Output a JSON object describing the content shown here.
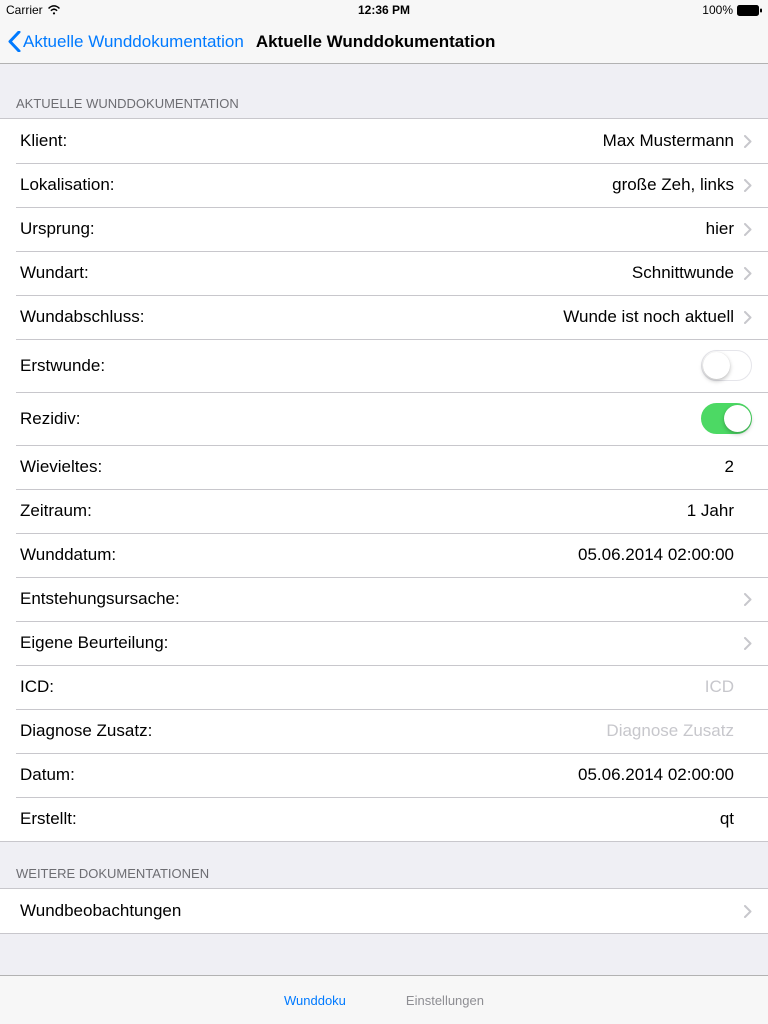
{
  "status": {
    "carrier": "Carrier",
    "time": "12:36 PM",
    "battery": "100%"
  },
  "nav": {
    "back_label": "Aktuelle Wunddokumentation",
    "title": "Aktuelle Wunddokumentation"
  },
  "section1": {
    "header": "AKTUELLE WUNDDOKUMENTATION",
    "klient_label": "Klient:",
    "klient_value": "Max Mustermann",
    "lokalisation_label": "Lokalisation:",
    "lokalisation_value": "große Zeh, links",
    "ursprung_label": "Ursprung:",
    "ursprung_value": "hier",
    "wundart_label": "Wundart:",
    "wundart_value": "Schnittwunde",
    "wundabschluss_label": "Wundabschluss:",
    "wundabschluss_value": "Wunde ist noch aktuell",
    "erstwunde_label": "Erstwunde:",
    "rezidiv_label": "Rezidiv:",
    "wievieltes_label": "Wievieltes:",
    "wievieltes_value": "2",
    "zeitraum_label": "Zeitraum:",
    "zeitraum_value": "1 Jahr",
    "wunddatum_label": "Wunddatum:",
    "wunddatum_value": "05.06.2014 02:00:00",
    "entstehungsursache_label": "Entstehungsursache:",
    "entstehungsursache_value": "",
    "eigene_beurteilung_label": "Eigene Beurteilung:",
    "eigene_beurteilung_value": "",
    "icd_label": "ICD:",
    "icd_placeholder": "ICD",
    "diagnose_zusatz_label": "Diagnose Zusatz:",
    "diagnose_zusatz_placeholder": "Diagnose Zusatz",
    "datum_label": "Datum:",
    "datum_value": "05.06.2014 02:00:00",
    "erstellt_label": "Erstellt:",
    "erstellt_value": "qt"
  },
  "section2": {
    "header": "WEITERE DOKUMENTATIONEN",
    "wundbeobachtungen_label": "Wundbeobachtungen"
  },
  "tabs": {
    "wunddoku": "Wunddoku",
    "einstellungen": "Einstellungen"
  }
}
